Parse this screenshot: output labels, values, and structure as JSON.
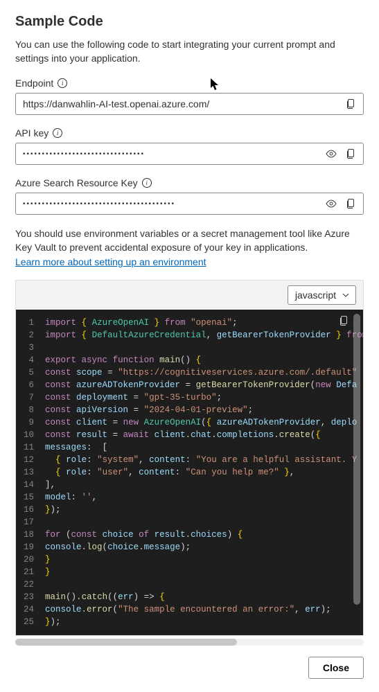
{
  "title": "Sample Code",
  "description": "You can use the following code to start integrating your current prompt and settings into your application.",
  "fields": {
    "endpoint": {
      "label": "Endpoint",
      "value": "https://danwahlin-AI-test.openai.azure.com/"
    },
    "apiKey": {
      "label": "API key",
      "value": "••••••••••••••••••••••••••••••••"
    },
    "searchKey": {
      "label": "Azure Search Resource Key",
      "value": "••••••••••••••••••••••••••••••••••••••••"
    }
  },
  "hint": "You should use environment variables or a secret management tool like Azure Key Vault to prevent accidental exposure of your key in applications.",
  "linkText": "Learn more about setting up an environment",
  "language": "javascript",
  "closeLabel": "Close",
  "code": {
    "lines": [
      "import { AzureOpenAI } from \"openai\";",
      "import { DefaultAzureCredential, getBearerTokenProvider } from",
      "",
      "export async function main() {",
      "const scope = \"https://cognitiveservices.azure.com/.default\"",
      "const azureADTokenProvider = getBearerTokenProvider(new Defa",
      "const deployment = \"gpt-35-turbo\";",
      "const apiVersion = \"2024-04-01-preview\";",
      "const client = new AzureOpenAI({ azureADTokenProvider, deplo",
      "const result = await client.chat.completions.create({",
      "messages:  [",
      "  { role: \"system\", content: \"You are a helpful assistant. Y",
      "  { role: \"user\", content: \"Can you help me?\" },",
      "],",
      "model: '',",
      "});",
      "",
      "for (const choice of result.choices) {",
      "console.log(choice.message);",
      "}",
      "}",
      "",
      "main().catch((err) => {",
      "console.error(\"The sample encountered an error:\", err);",
      "});"
    ]
  }
}
